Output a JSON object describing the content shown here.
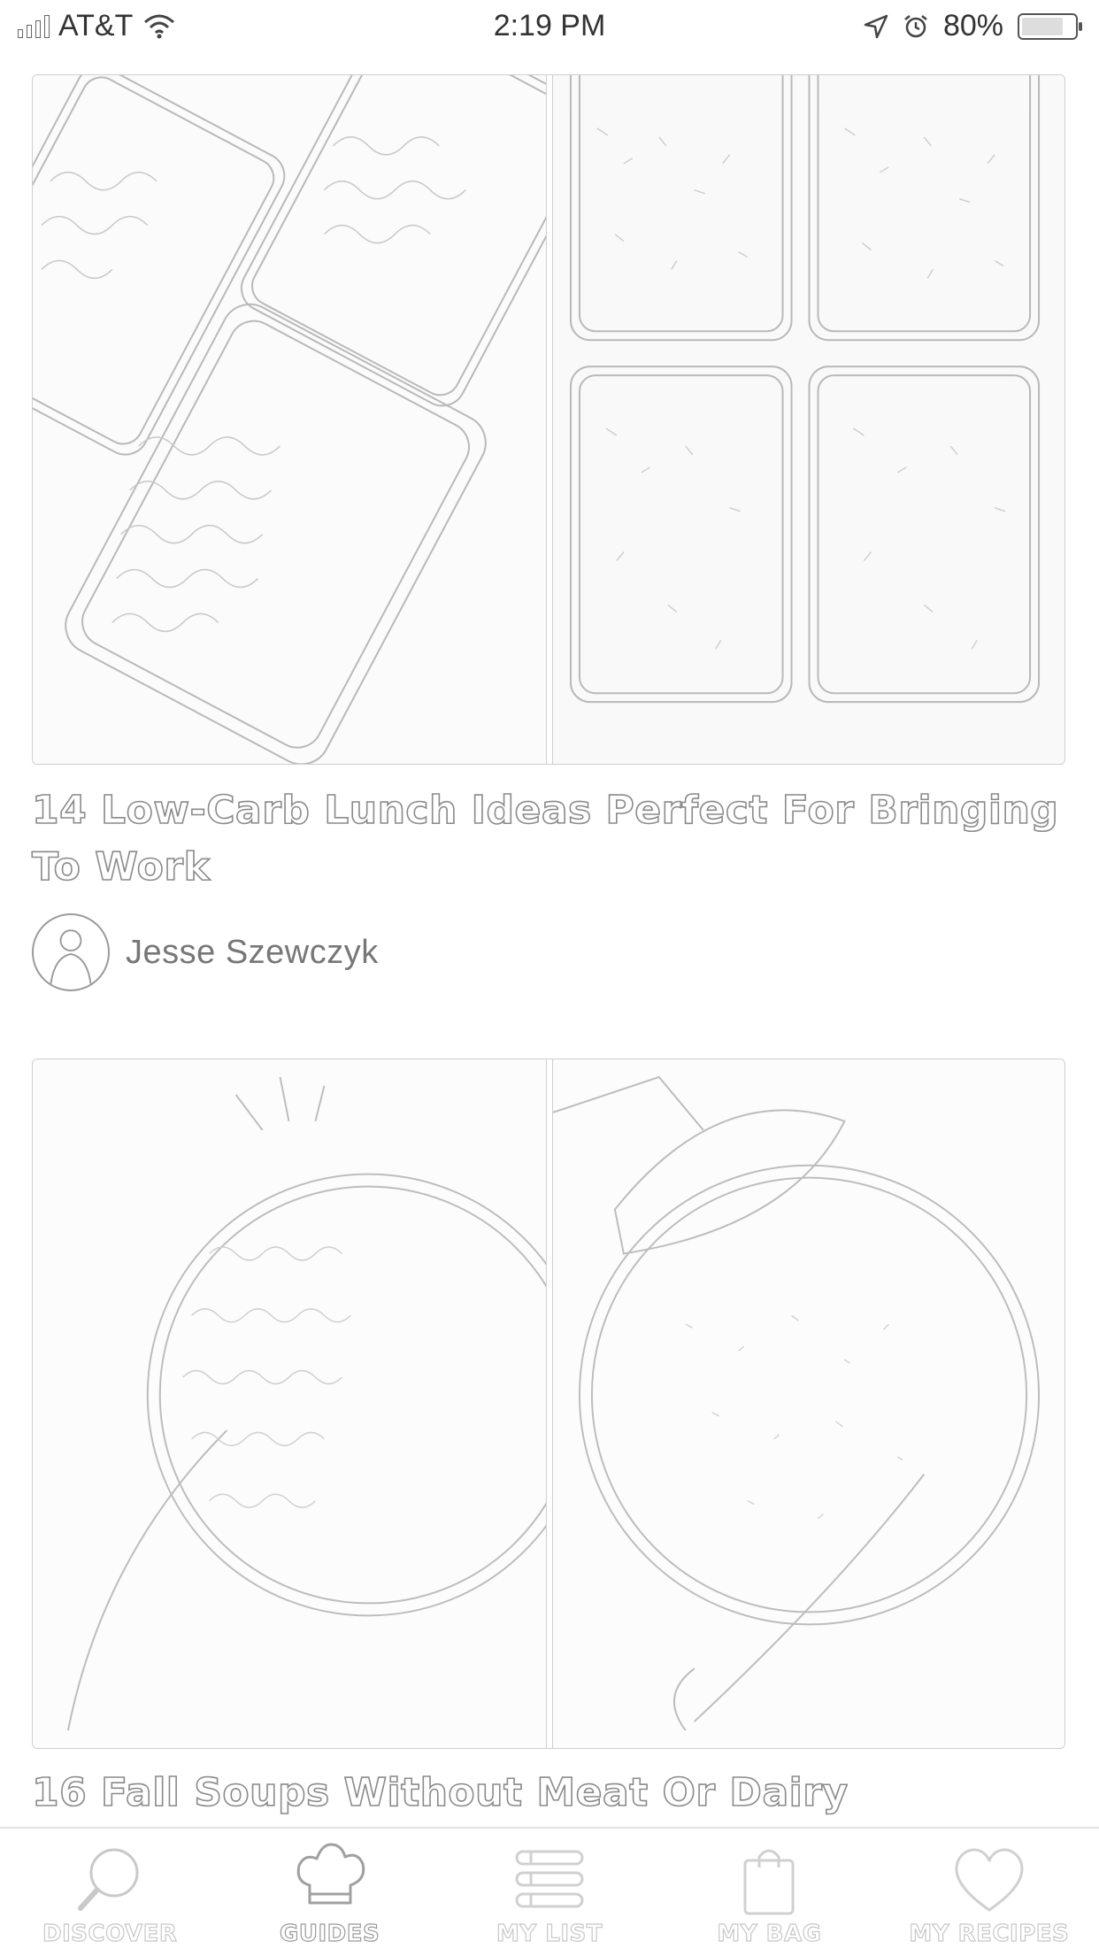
{
  "status_bar": {
    "carrier": "AT&T",
    "time": "2:19 PM",
    "battery": "80%",
    "battery_level": 0.8
  },
  "guides": [
    {
      "title": "14 Low-Carb Lunch Ideas Perfect For Bringing To Work",
      "author": "Jesse Szewczyk"
    },
    {
      "title": "16 Fall Soups Without Meat Or Dairy"
    }
  ],
  "tabs": [
    {
      "label": "DISCOVER",
      "icon": "search-icon"
    },
    {
      "label": "GUIDES",
      "icon": "chef-hat-icon",
      "active": true
    },
    {
      "label": "MY LIST",
      "icon": "list-icon"
    },
    {
      "label": "MY BAG",
      "icon": "shopping-bag-icon"
    },
    {
      "label": "MY RECIPES",
      "icon": "heart-icon"
    }
  ]
}
